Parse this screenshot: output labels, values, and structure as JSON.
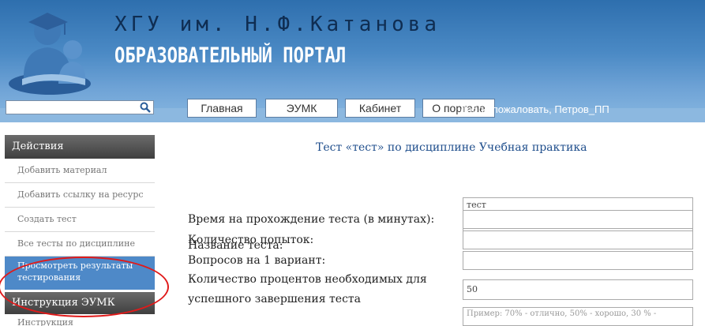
{
  "header": {
    "title_line1": "ХГУ им. Н.Ф.Катанова",
    "title_line2": "ОБРАЗОВАТЕЛЬНЫЙ ПОРТАЛ",
    "logo_icon": "graduate-logo-icon"
  },
  "search": {
    "value": "",
    "icon": "search-icon"
  },
  "nav": {
    "items": [
      {
        "label": "Главная"
      },
      {
        "label": "ЭУМК"
      },
      {
        "label": "Кабинет"
      },
      {
        "label": "О портале"
      }
    ],
    "welcome": "Добро пожаловать, Петров_ПП"
  },
  "sidebar": {
    "section1": "Действия",
    "items": [
      {
        "label": "Добавить материал"
      },
      {
        "label": "Добавить ссылку на ресурс"
      },
      {
        "label": "Создать тест"
      },
      {
        "label": "Все тесты по дисциплине"
      }
    ],
    "active_line1": "Просмотреть результаты",
    "active_line2": "тестирования",
    "section2": "Инструкция ЭУМК",
    "cut_item": "Инструкция"
  },
  "main": {
    "title": "Тест «тест» по дисциплине Учебная практика",
    "form": {
      "name_label": "Название теста:",
      "name_value": "тест",
      "time_label": "Время на прохождение теста (в минутах):",
      "time_value": "",
      "attempts_label": "Количество попыток:",
      "attempts_value": "",
      "questions_label": "Вопросов на 1 вариант:",
      "questions_value": "",
      "percent_label_1": "Количество процентов необходимых для",
      "percent_label_2": "успешного завершения теста",
      "percent_value": "50",
      "hint_text": "Пример: 70% - отлично, 50% - хорошо, 30 % -"
    }
  },
  "colors": {
    "header_blue": "#4b8ac5",
    "sidebar_active": "#4e89c8",
    "title_blue": "#1f4e8c",
    "annotation_red": "#e01a1a"
  }
}
